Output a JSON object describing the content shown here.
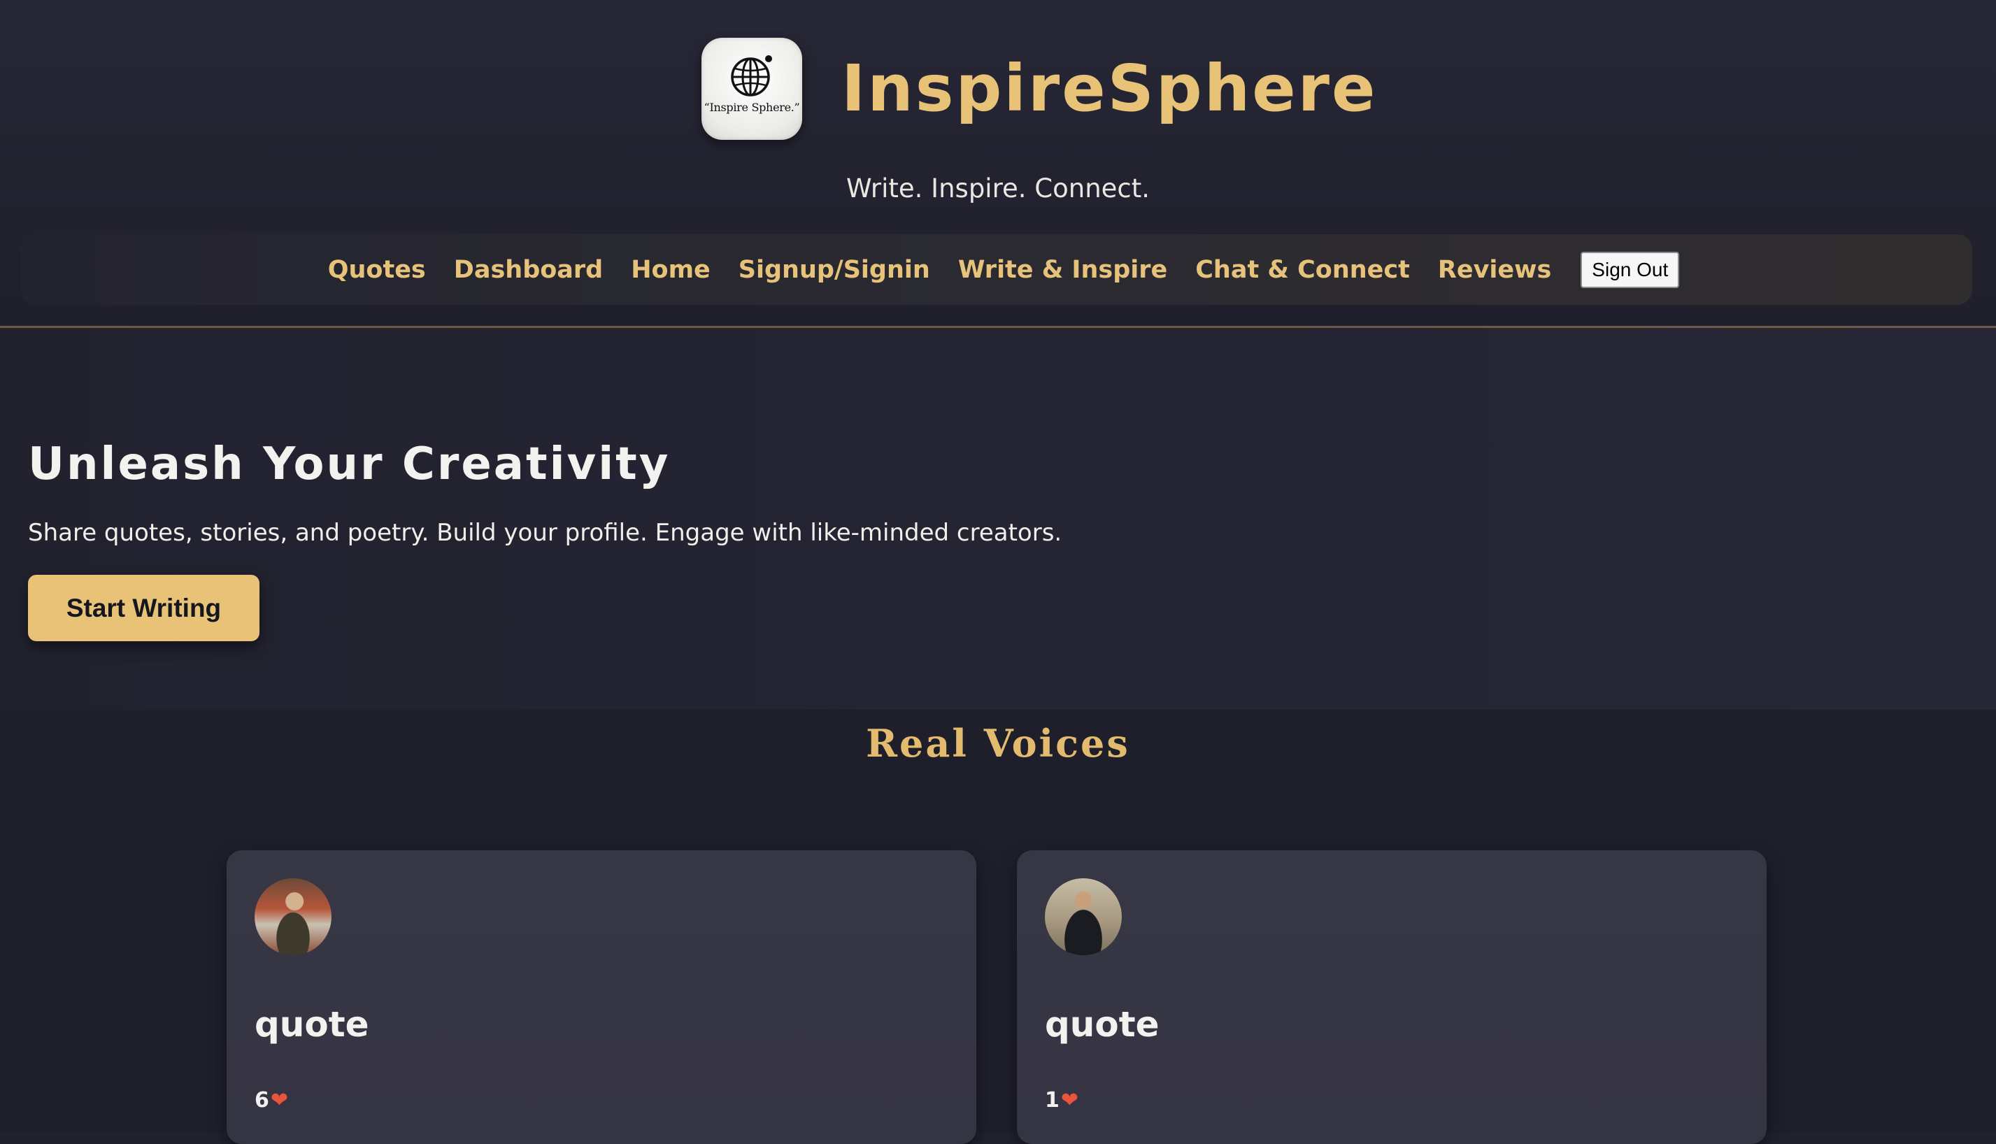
{
  "brand": {
    "logo_icon": "globe-icon",
    "logo_text": "“Inspire Sphere.”",
    "title": "InspireSphere",
    "tagline": "Write. Inspire. Connect."
  },
  "nav": {
    "links": [
      "Quotes",
      "Dashboard",
      "Home",
      "Signup/Signin",
      "Write & Inspire",
      "Chat & Connect",
      "Reviews"
    ],
    "signout_label": "Sign Out"
  },
  "hero": {
    "title": "Unleash Your Creativity",
    "subtitle": "Share quotes, stories, and poetry. Build your profile. Engage with like-minded creators.",
    "cta_label": "Start Writing"
  },
  "voices": {
    "title": "Real Voices",
    "cards": [
      {
        "type": "quote",
        "likes": "6",
        "like_icon": "heart-icon"
      },
      {
        "type": "quote",
        "likes": "1",
        "like_icon": "heart-icon"
      }
    ]
  },
  "colors": {
    "accent": "#e8c377",
    "background": "#22222f",
    "card": "#373645",
    "heart": "#e8553a"
  }
}
